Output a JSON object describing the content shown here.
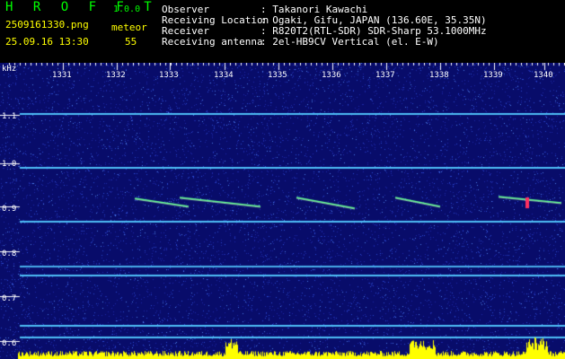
{
  "header": {
    "app_name": "H R O F F T",
    "version": "1.0.0",
    "filename": "2509161330.png",
    "category": "meteor",
    "datetime": "25.09.16 13:30",
    "count": "55",
    "fields": [
      {
        "label": "Observer",
        "value": ": Takanori Kawachi"
      },
      {
        "label": "Receiving Location",
        "value": ": Ogaki, Gifu, JAPAN (136.60E, 35.35N)"
      },
      {
        "label": "Receiver",
        "value": ": R820T2(RTL-SDR) SDR-Sharp 53.1000MHz"
      },
      {
        "label": "Receiving antenna",
        "value": ": 2el-HB9CV Vertical (el. E-W)"
      }
    ]
  },
  "spectrogram": {
    "unit_label": "kHz",
    "time_ticks": [
      "1331",
      "1332",
      "1333",
      "1334",
      "1335",
      "1336",
      "1337",
      "1338",
      "1339",
      "1340"
    ],
    "freq_ticks": [
      "1.1",
      "1.0",
      "0.9",
      "0.8",
      "0.7",
      "0.6"
    ],
    "colors": {
      "background": "#080c6a",
      "line": "#52c8ff",
      "echo": "#60ff90",
      "ticks": "#ffffff",
      "level": "#ffff00"
    }
  }
}
